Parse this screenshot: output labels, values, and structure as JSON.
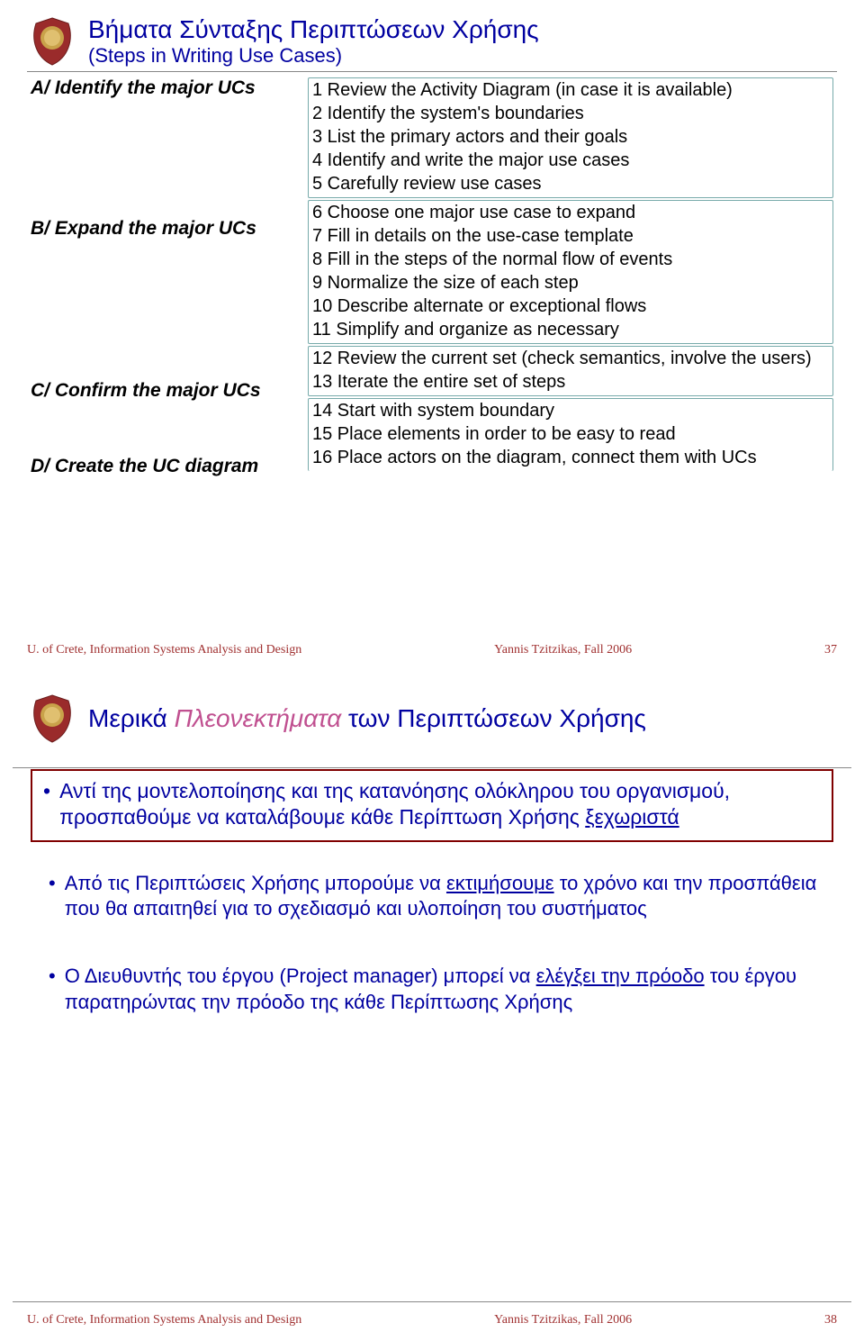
{
  "slide1": {
    "title_main": "Βήματα Σύνταξης Περιπτώσεων Χρήσης",
    "title_sub": "(Steps in Writing Use Cases)",
    "left": {
      "a": "A/ Identify the major UCs",
      "b": "B/ Expand the major UCs",
      "c": "C/ Confirm the major UCs",
      "d": "D/ Create the UC diagram"
    },
    "groupA": [
      "1 Review the Activity Diagram (in case it is available)",
      "2 Identify the system's boundaries",
      "3 List the primary actors and their goals",
      "4 Identify and write the major use cases",
      "5 Carefully review use cases"
    ],
    "groupB": [
      "6 Choose one major use case to expand",
      "7 Fill in details on the use-case template",
      "8 Fill in the steps of the normal flow of events",
      "9 Normalize the size of each step",
      "10 Describe alternate or exceptional flows",
      "11 Simplify and organize as necessary"
    ],
    "groupC": [
      "12 Review the current set (check semantics, involve the users)",
      "13 Iterate the entire set of steps"
    ],
    "groupD": [
      "14 Start with system boundary",
      "15 Place elements in order to be easy to read",
      "16 Place actors on the diagram, connect them with UCs"
    ],
    "footer_left": "U. of Crete, Information Systems Analysis and Design",
    "footer_mid": "Yannis Tzitzikas, Fall 2006",
    "footer_right": "37"
  },
  "slide2": {
    "title_pre": "Μερικά ",
    "title_em": "Πλεονεκτήματα",
    "title_post": " των Περιπτώσεων Χρήσης",
    "b1_pre": "Αντί της μοντελοποίησης και της κατανόησης ολόκληρου του οργανισμού, προσπαθούμε να καταλάβουμε κάθε Περίπτωση Χρήσης ",
    "b1_u": "ξεχωριστά",
    "b2_pre": "Από τις Περιπτώσεις Χρήσης μπορούμε να ",
    "b2_u": "εκτιμήσουμε",
    "b2_post": " το χρόνο και την προσπάθεια που θα απαιτηθεί για το σχεδιασμό και υλοποίηση του συστήματος",
    "b3_pre": "Ο Διευθυντής του έργου (Project manager) μπορεί να ",
    "b3_u": "ελέγξει την πρόοδο",
    "b3_post": " του έργου παρατηρώντας την πρόοδο της κάθε Περίπτωσης Χρήσης",
    "footer_left": "U. of Crete, Information Systems Analysis and Design",
    "footer_mid": "Yannis Tzitzikas, Fall 2006",
    "footer_right": "38"
  }
}
